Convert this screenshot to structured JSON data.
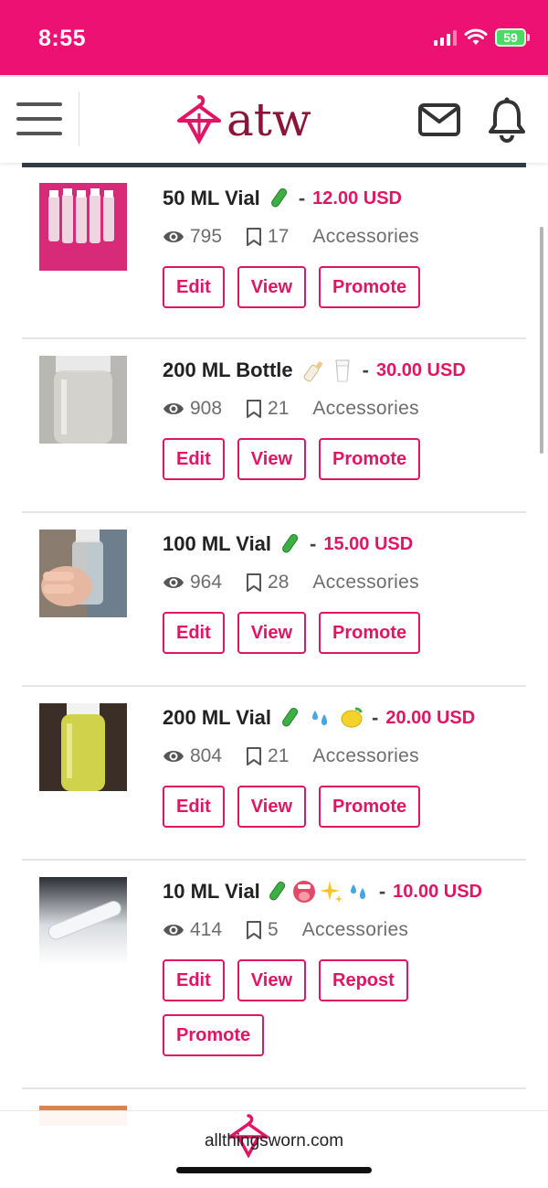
{
  "status_bar": {
    "time": "8:55",
    "battery": "59"
  },
  "header": {
    "logo_text": "atw"
  },
  "listings": [
    {
      "title": "50 ML Vial",
      "emojis": [
        "test-tube"
      ],
      "price": "12.00 USD",
      "views": "795",
      "saves": "17",
      "category": "Accessories",
      "buttons": [
        "Edit",
        "View",
        "Promote"
      ]
    },
    {
      "title": "200 ML Bottle",
      "emojis": [
        "baby-bottle",
        "glass-of-milk"
      ],
      "price": "30.00 USD",
      "views": "908",
      "saves": "21",
      "category": "Accessories",
      "buttons": [
        "Edit",
        "View",
        "Promote"
      ]
    },
    {
      "title": "100 ML Vial",
      "emojis": [
        "test-tube"
      ],
      "price": "15.00 USD",
      "views": "964",
      "saves": "28",
      "category": "Accessories",
      "buttons": [
        "Edit",
        "View",
        "Promote"
      ]
    },
    {
      "title": "200 ML Vial",
      "emojis": [
        "test-tube",
        "sweat-droplets",
        "lemon"
      ],
      "price": "20.00 USD",
      "views": "804",
      "saves": "21",
      "category": "Accessories",
      "buttons": [
        "Edit",
        "View",
        "Promote"
      ]
    },
    {
      "title": "10 ML Vial",
      "emojis": [
        "test-tube",
        "tongue-face",
        "sparkles",
        "sweat-droplets"
      ],
      "price": "10.00 USD",
      "views": "414",
      "saves": "5",
      "category": "Accessories",
      "buttons": [
        "Edit",
        "View",
        "Repost",
        "Promote"
      ]
    }
  ],
  "footer": {
    "url": "allthingsworn.com"
  },
  "colors": {
    "brand_pink": "#ec1173",
    "accent": "#e21565",
    "logo_maroon": "#8b1538"
  }
}
